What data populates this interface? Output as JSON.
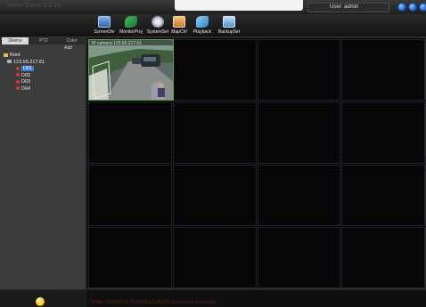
{
  "window": {
    "title": "Video Client 3.4.14",
    "user_label": "User: admin",
    "buttons": [
      "minimize-icon",
      "maximize-icon",
      "close-icon"
    ],
    "accent": "#2a78d8"
  },
  "toolbar": {
    "items": [
      {
        "label": "ScreenDiv",
        "icon": "screen-division-icon",
        "color": "#4a7fc2"
      },
      {
        "label": "MonitorProj",
        "icon": "monitor-project-icon",
        "color": "#2d9c4e"
      },
      {
        "label": "SystemSet",
        "icon": "system-settings-icon",
        "color": "#9aa4b1"
      },
      {
        "label": "MapCtrl",
        "icon": "map-icon",
        "color": "#d98b3a"
      },
      {
        "label": "Playback",
        "icon": "playback-icon",
        "color": "#42a5d8"
      },
      {
        "label": "BackupSet",
        "icon": "backup-icon",
        "color": "#5b9bd8"
      }
    ]
  },
  "sidebar": {
    "tabs": [
      {
        "label": "Device",
        "active": true
      },
      {
        "label": "PTZ",
        "active": false
      },
      {
        "label": "Color",
        "active": false
      }
    ],
    "add_label": "Add",
    "tree": [
      {
        "label": "Root",
        "level": 0,
        "selected": false
      },
      {
        "label": "123.65.217.61",
        "level": 1,
        "selected": false
      },
      {
        "label": "D01",
        "level": 2,
        "selected": true
      },
      {
        "label": "D02",
        "level": 2,
        "selected": false
      },
      {
        "label": "D03",
        "level": 2,
        "selected": false
      },
      {
        "label": "D04",
        "level": 2,
        "selected": false
      }
    ]
  },
  "video_grid": {
    "rows": 4,
    "cols": 4,
    "active_cell": 0,
    "active_camera_label": "IP camera 123.65.217.61"
  },
  "status": {
    "notify": "Notify: 2013-07-16 15:08:03 123.65.217.61 connect successful."
  }
}
